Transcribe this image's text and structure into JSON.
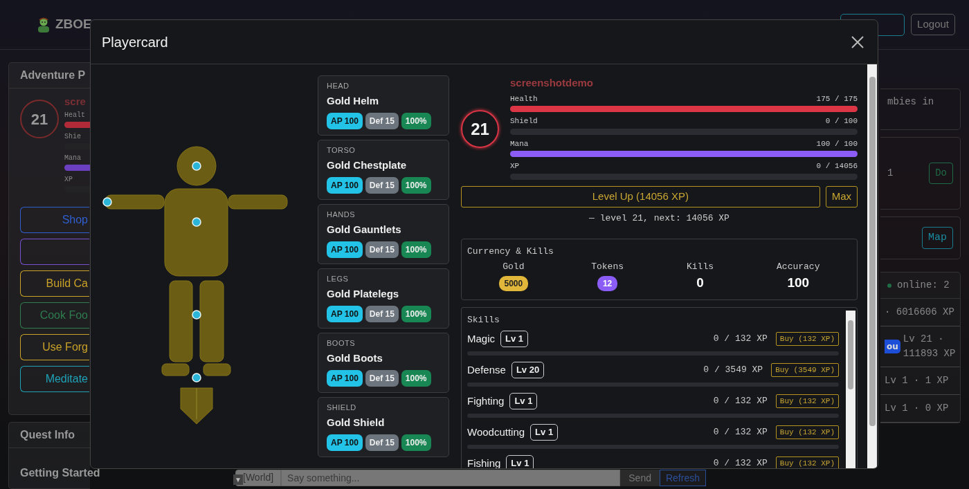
{
  "background": {
    "navbar": {
      "brand": "ZBOE",
      "logout": "Logout"
    },
    "adventure_panel": {
      "title": "Adventure P",
      "level": "21",
      "name": "scre",
      "stats": [
        {
          "label": "Healt",
          "level": 1,
          "color": "#b02a37"
        },
        {
          "label": "Shie",
          "level": 0
        },
        {
          "label": "Mana",
          "level": 1,
          "color": "#6a3fc0"
        },
        {
          "label": "XP",
          "level": 0
        }
      ],
      "buttons": [
        {
          "label": "Shop",
          "color": "#2f5fd0"
        },
        {
          "color": "#7a4fd0"
        },
        {
          "label": "Build Ca",
          "color": "#c9a227"
        },
        {
          "label": "Cook Foo",
          "color": "#2e7d4f"
        },
        {
          "label": "Use Forg",
          "color": "#c9a227"
        },
        {
          "label": "Meditate",
          "color": "#1fa2b8"
        }
      ]
    },
    "quest_panel": {
      "title": "Quest Info",
      "quest": "Getting Started"
    },
    "chat": {
      "scroll_arrow": "▼",
      "channel": "[World]",
      "placeholder": "Say something...",
      "send": "Send",
      "refresh": "Refresh"
    },
    "right_panel": {
      "quest_text": "mbies in",
      "task_count": "1",
      "do": "Do",
      "map": "Map",
      "online": "online: 2",
      "players": [
        {
          "text": "· 6016606 XP"
        },
        {
          "badge": "ou",
          "text": "Lv 21 · 111893 XP"
        },
        {
          "text": "Lv 1 · 1 XP"
        },
        {
          "text": "Lv 1 · 0 XP"
        }
      ]
    }
  },
  "modal": {
    "title": "Playercard",
    "equipment": [
      {
        "slot": "HEAD",
        "name": "Gold Helm",
        "ap": "AP 100",
        "def": "Def 15",
        "durability": "100%"
      },
      {
        "slot": "TORSO",
        "name": "Gold Chestplate",
        "ap": "AP 100",
        "def": "Def 15",
        "durability": "100%"
      },
      {
        "slot": "HANDS",
        "name": "Gold Gauntlets",
        "ap": "AP 100",
        "def": "Def 15",
        "durability": "100%"
      },
      {
        "slot": "LEGS",
        "name": "Gold Platelegs",
        "ap": "AP 100",
        "def": "Def 15",
        "durability": "100%"
      },
      {
        "slot": "BOOTS",
        "name": "Gold Boots",
        "ap": "AP 100",
        "def": "Def 15",
        "durability": "100%"
      },
      {
        "slot": "SHIELD",
        "name": "Gold Shield",
        "ap": "AP 100",
        "def": "Def 15",
        "durability": "100%"
      }
    ],
    "player": {
      "level": "21",
      "name": "screenshotdemo",
      "bars": [
        {
          "label": "Health",
          "reading": "175 / 175",
          "level": 1,
          "color": "#dc3545"
        },
        {
          "label": "Shield",
          "reading": "0 / 100",
          "level": 0
        },
        {
          "label": "Mana",
          "reading": "100 / 100",
          "level": 1,
          "color": "#8b5cf6"
        },
        {
          "label": "XP",
          "reading": "0 / 14056",
          "level": 0
        }
      ],
      "level_up": "Level Up (14056 XP)",
      "max": "Max",
      "note": "— level 21, next: 14056 XP"
    },
    "currency": {
      "title": "Currency & Kills",
      "items": [
        {
          "label": "Gold",
          "value": "5000",
          "kind": "pill",
          "color": "#e0b73a"
        },
        {
          "label": "Tokens",
          "value": "12",
          "kind": "pill",
          "color": "#8b5cf6"
        },
        {
          "label": "Kills",
          "value": "0",
          "kind": "plain"
        },
        {
          "label": "Accuracy",
          "value": "100",
          "kind": "plain"
        }
      ]
    },
    "skills": {
      "title": "Skills",
      "items": [
        {
          "name": "Magic",
          "badge": "Lv 1",
          "reading": "0 / 132 XP",
          "buy": "Buy (132 XP)",
          "level": 0
        },
        {
          "name": "Defense",
          "badge": "Lv 20",
          "reading": "0 / 3549 XP",
          "buy": "Buy (3549 XP)",
          "level": 0
        },
        {
          "name": "Fighting",
          "badge": "Lv 1",
          "reading": "0 / 132 XP",
          "buy": "Buy (132 XP)",
          "level": 0
        },
        {
          "name": "Woodcutting",
          "badge": "Lv 1",
          "reading": "0 / 132 XP",
          "buy": "Buy (132 XP)",
          "level": 0
        },
        {
          "name": "Fishing",
          "badge": "Lv 1",
          "reading": "0 / 132 XP",
          "buy": "Buy (132 XP)"
        }
      ]
    }
  }
}
